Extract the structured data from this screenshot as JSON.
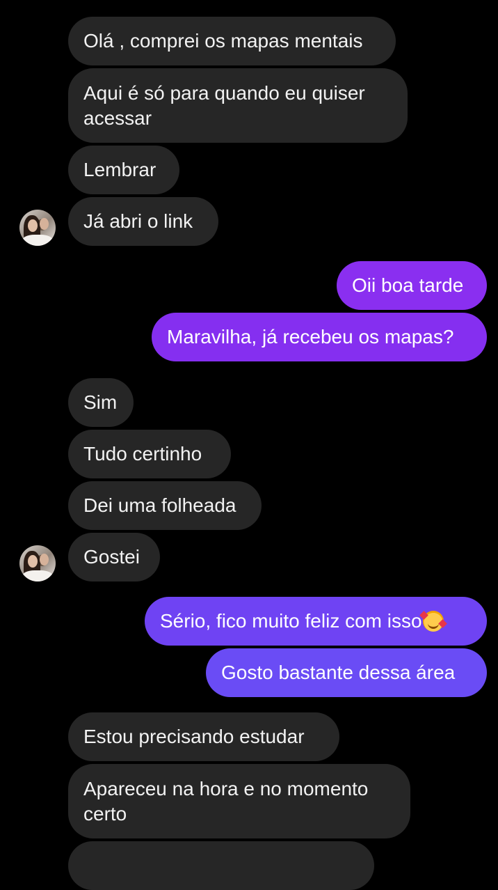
{
  "colors": {
    "background": "#000000",
    "incoming_bubble": "#262626",
    "outgoing_gradient_top": "#8a2df0",
    "outgoing_gradient_bottom": "#6a4cf5"
  },
  "messages": [
    {
      "side": "in",
      "text": "Olá , comprei os mapas mentais"
    },
    {
      "side": "in",
      "text": "Aqui é só para quando eu quiser\nacessar"
    },
    {
      "side": "in",
      "text": "Lembrar"
    },
    {
      "side": "in",
      "text": "Já abri o link",
      "avatar": "contact-avatar"
    },
    {
      "side": "out",
      "text": "Oii boa tarde"
    },
    {
      "side": "out",
      "text": "Maravilha, já recebeu os mapas?"
    },
    {
      "side": "in",
      "text": "Sim"
    },
    {
      "side": "in",
      "text": "Tudo certinho"
    },
    {
      "side": "in",
      "text": "Dei uma folheada"
    },
    {
      "side": "in",
      "text": "Gostei",
      "avatar": "contact-avatar"
    },
    {
      "side": "out",
      "text": "Sério, fico muito feliz com isso",
      "emoji": "smiling-face-with-hearts-icon"
    },
    {
      "side": "out",
      "text": "Gosto bastante dessa área"
    },
    {
      "side": "in",
      "text": "Estou precisando estudar"
    },
    {
      "side": "in",
      "text": "Apareceu na hora e no momento\ncerto"
    }
  ]
}
